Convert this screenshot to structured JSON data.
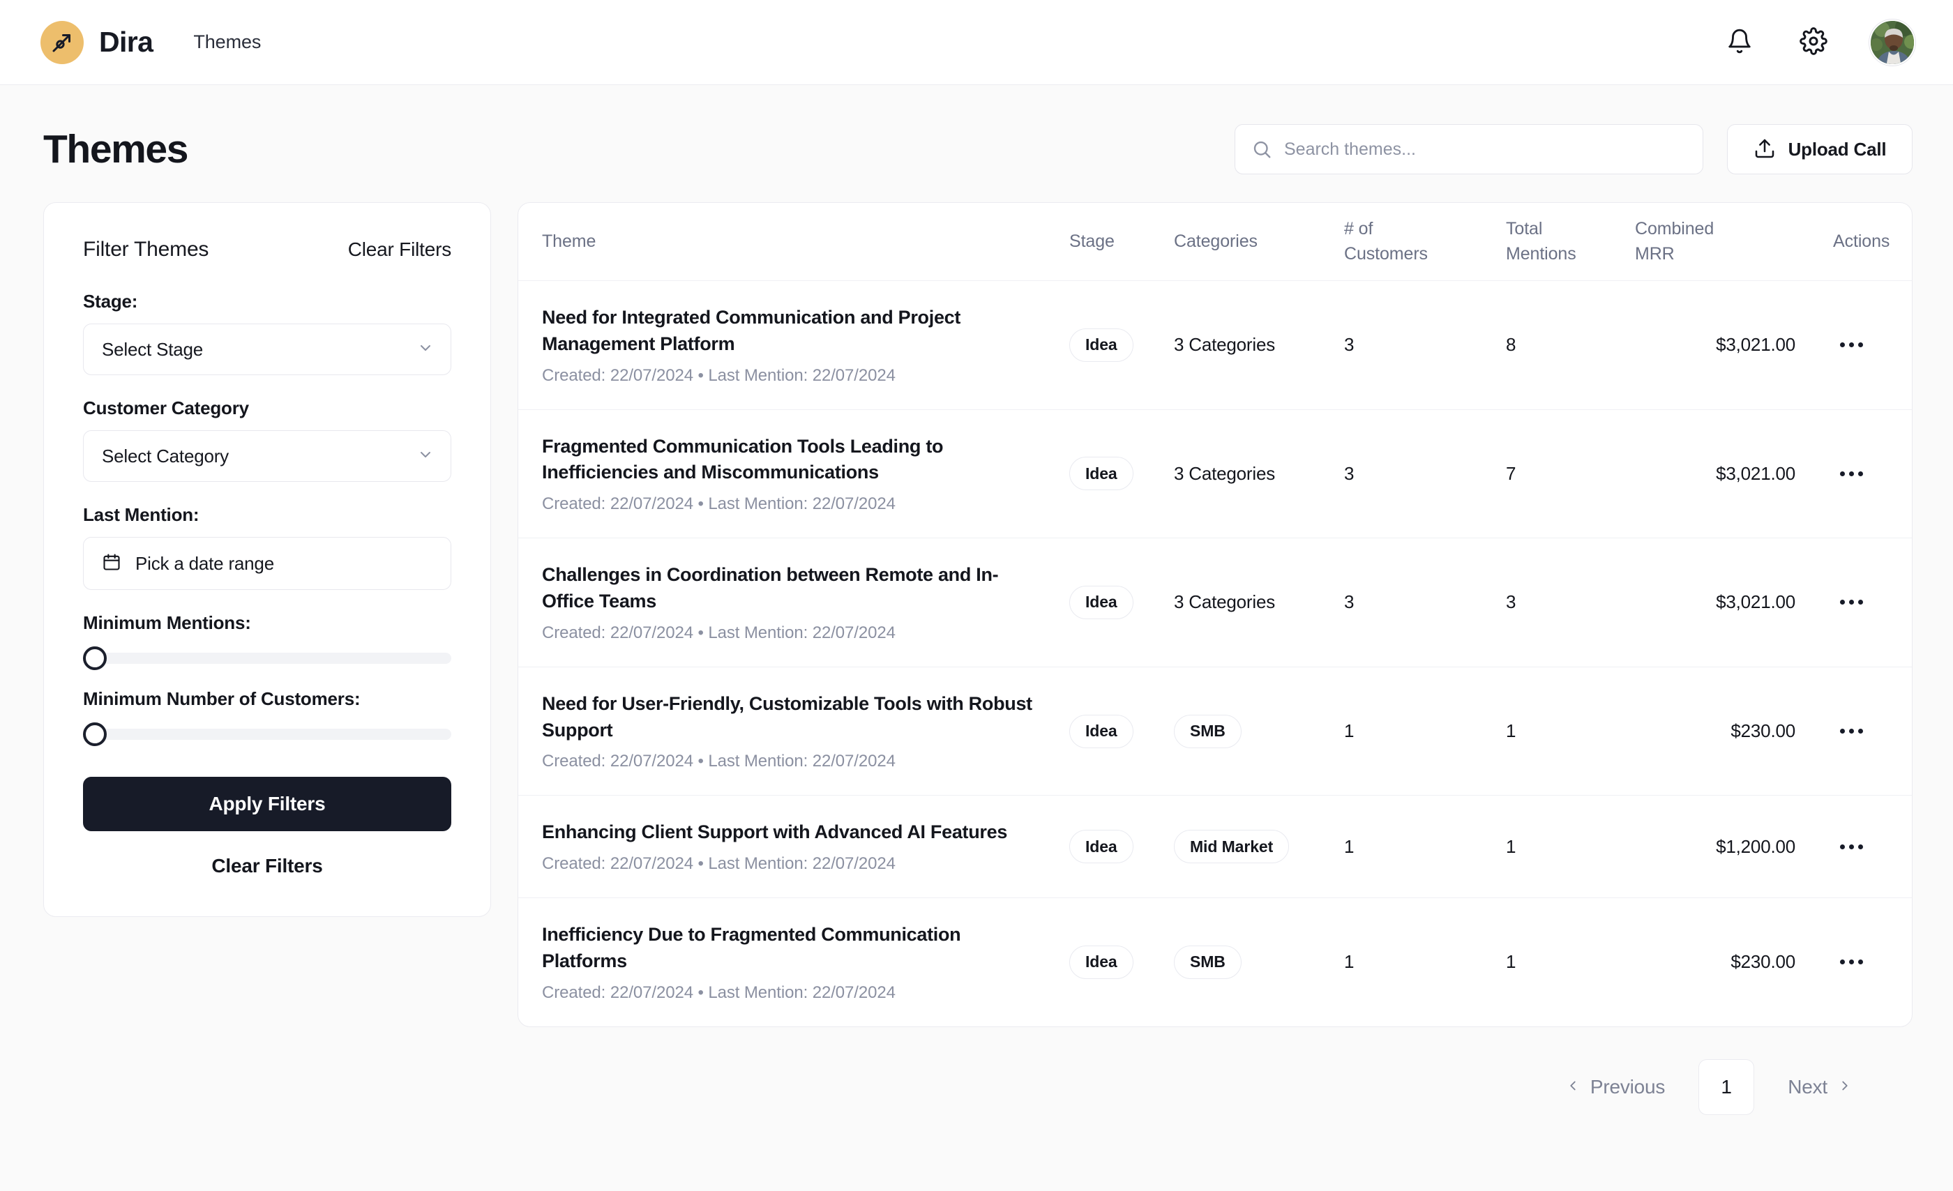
{
  "brand": {
    "name": "Dira",
    "badge_color": "#edbe6c",
    "icon": "arrow-up-right-circle-icon"
  },
  "topnav": {
    "link_label": "Themes",
    "notifications_icon": "bell-icon",
    "settings_icon": "gear-icon",
    "avatar_icon": "user-avatar"
  },
  "page": {
    "title": "Themes"
  },
  "search": {
    "placeholder": "Search themes...",
    "value": "",
    "icon": "search-icon"
  },
  "upload": {
    "label": "Upload Call",
    "icon": "upload-icon"
  },
  "filters": {
    "title": "Filter Themes",
    "clear_top_label": "Clear Filters",
    "stage_label": "Stage:",
    "stage_value": "Select Stage",
    "category_label": "Customer Category",
    "category_value": "Select Category",
    "last_mention_label": "Last Mention:",
    "date_placeholder": "Pick a date range",
    "date_icon": "calendar-icon",
    "min_mentions_label": "Minimum Mentions:",
    "min_mentions_value": 0,
    "min_customers_label": "Minimum Number of Customers:",
    "min_customers_value": 0,
    "apply_label": "Apply Filters",
    "clear_bottom_label": "Clear Filters",
    "chevron_icon": "chevron-down-icon"
  },
  "table": {
    "headers": {
      "theme": "Theme",
      "stage": "Stage",
      "categories": "Categories",
      "customers_line1": "# of",
      "customers_line2": "Customers",
      "mentions_line1": "Total",
      "mentions_line2": "Mentions",
      "mrr_line1": "Combined",
      "mrr_line2": "MRR",
      "actions": "Actions"
    },
    "rows": [
      {
        "theme": "Need for Integrated Communication and Project Management Platform",
        "meta": "Created: 22/07/2024 • Last Mention: 22/07/2024",
        "stage": "Idea",
        "categories": "3 Categories",
        "categories_is_pill": false,
        "customers": "3",
        "mentions": "8",
        "mrr": "$3,021.00",
        "actions_icon": "more-horizontal-icon"
      },
      {
        "theme": "Fragmented Communication Tools Leading to Inefficiencies and Miscommunications",
        "meta": "Created: 22/07/2024 • Last Mention: 22/07/2024",
        "stage": "Idea",
        "categories": "3 Categories",
        "categories_is_pill": false,
        "customers": "3",
        "mentions": "7",
        "mrr": "$3,021.00",
        "actions_icon": "more-horizontal-icon"
      },
      {
        "theme": "Challenges in Coordination between Remote and In-Office Teams",
        "meta": "Created: 22/07/2024 • Last Mention: 22/07/2024",
        "stage": "Idea",
        "categories": "3 Categories",
        "categories_is_pill": false,
        "customers": "3",
        "mentions": "3",
        "mrr": "$3,021.00",
        "actions_icon": "more-horizontal-icon"
      },
      {
        "theme": "Need for User-Friendly, Customizable Tools with Robust Support",
        "meta": "Created: 22/07/2024 • Last Mention: 22/07/2024",
        "stage": "Idea",
        "categories": "SMB",
        "categories_is_pill": true,
        "customers": "1",
        "mentions": "1",
        "mrr": "$230.00",
        "actions_icon": "more-horizontal-icon"
      },
      {
        "theme": "Enhancing Client Support with Advanced AI Features",
        "meta": "Created: 22/07/2024 • Last Mention: 22/07/2024",
        "stage": "Idea",
        "categories": "Mid Market",
        "categories_is_pill": true,
        "customers": "1",
        "mentions": "1",
        "mrr": "$1,200.00",
        "actions_icon": "more-horizontal-icon"
      },
      {
        "theme": "Inefficiency Due to Fragmented Communication Platforms",
        "meta": "Created: 22/07/2024 • Last Mention: 22/07/2024",
        "stage": "Idea",
        "categories": "SMB",
        "categories_is_pill": true,
        "customers": "1",
        "mentions": "1",
        "mrr": "$230.00",
        "actions_icon": "more-horizontal-icon"
      }
    ]
  },
  "pagination": {
    "previous_label": "Previous",
    "next_label": "Next",
    "current_page": "1",
    "prev_icon": "chevron-left-icon",
    "next_icon": "chevron-right-icon"
  }
}
